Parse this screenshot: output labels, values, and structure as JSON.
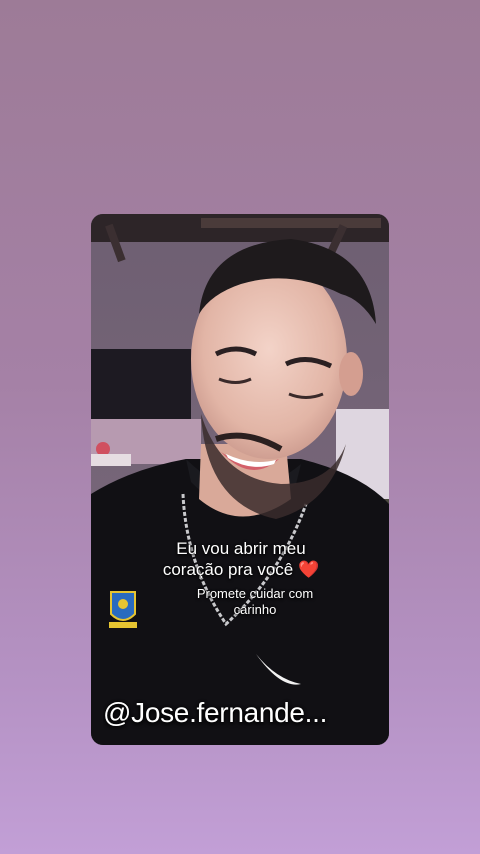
{
  "story": {
    "caption_line1": "Eu vou abrir meu",
    "caption_line2": "coração pra você",
    "caption_emoji": "❤️",
    "sub_caption_line1": "Promete cuidar  com",
    "sub_caption_line2": "carinho",
    "handle": "@Jose.fernande..."
  },
  "colors": {
    "background_top": "#9d7b97",
    "background_bottom": "#c29fd6",
    "caption_text": "#ffffff",
    "heart": "#e0182d"
  },
  "icons": [
    "heart-emoji-icon",
    "nike-swoosh-logo",
    "cbf-crest-logo"
  ]
}
